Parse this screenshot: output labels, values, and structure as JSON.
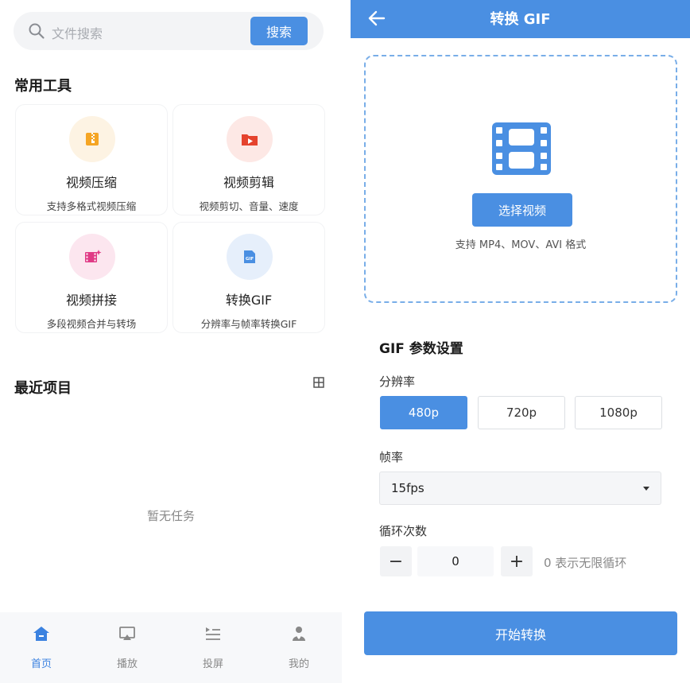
{
  "home": {
    "search": {
      "placeholder": "文件搜索",
      "button_label": "搜索",
      "icon": "search-icon"
    },
    "tools_section": {
      "title": "常用工具",
      "items": [
        {
          "name": "视频压缩",
          "desc": "支持多格式视频压缩",
          "icon": "zip-file-icon",
          "color": "#f5a524",
          "bg": "#fdf3e3"
        },
        {
          "name": "视频剪辑",
          "desc": "视频剪切、音量、速度",
          "icon": "video-folder-icon",
          "color": "#e5432e",
          "bg": "#fde8e5"
        },
        {
          "name": "视频拼接",
          "desc": "多段视频合并与转场",
          "icon": "film-merge-icon",
          "color": "#e03b86",
          "bg": "#fce6ef"
        },
        {
          "name": "转换GIF",
          "desc": "分辨率与帧率转换GIF",
          "icon": "gif-file-icon",
          "color": "#4a8fe2",
          "bg": "#e6effb"
        }
      ]
    },
    "recent_section": {
      "title": "最近项目",
      "toggle_icon": "grid-icon",
      "empty_text": "暂无任务"
    },
    "tabbar": [
      {
        "label": "首页",
        "icon": "home-icon",
        "active": true
      },
      {
        "label": "播放",
        "icon": "airplay-icon",
        "active": false
      },
      {
        "label": "投屏",
        "icon": "playlist-icon",
        "active": false
      },
      {
        "label": "我的",
        "icon": "user-icon",
        "active": false
      }
    ]
  },
  "gif_page": {
    "title": "转换 GIF",
    "back_icon": "arrow-left-icon",
    "upload": {
      "icon": "film-icon",
      "button_label": "选择视频",
      "formats_text": "支持 MP4、MOV、AVI 格式"
    },
    "params_title": "GIF 参数设置",
    "resolution": {
      "label": "分辨率",
      "options": [
        "480p",
        "720p",
        "1080p"
      ],
      "selected": "480p"
    },
    "framerate": {
      "label": "帧率",
      "selected": "15fps"
    },
    "loop": {
      "label": "循环次数",
      "value": "0",
      "minus": "−",
      "plus": "+",
      "hint": "0 表示无限循环"
    },
    "start_button": "开始转换"
  },
  "colors": {
    "primary": "#4a8fe2",
    "tab_active": "#3b82e0"
  }
}
